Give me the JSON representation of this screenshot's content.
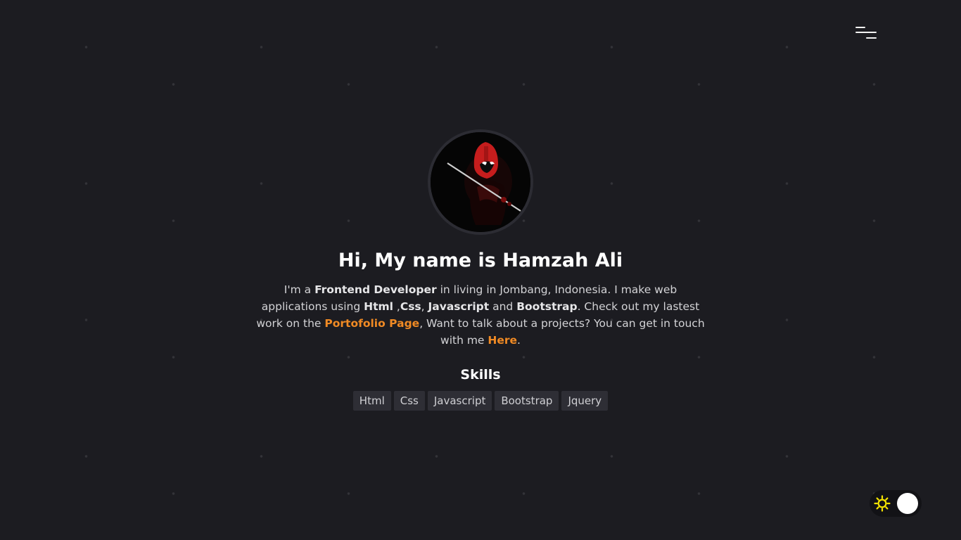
{
  "nav": {
    "menu_icon": "hamburger-menu-icon"
  },
  "profile": {
    "avatar_alt": "avatar",
    "greeting": "Hi, My name is Hamzah Ali"
  },
  "bio": {
    "t1": "I'm a ",
    "role": "Frontend Developer",
    "t2": " in living in Jombang, Indonesia. I make web applications using ",
    "skill_html": "Html",
    "t3": " ,",
    "skill_css": "Css",
    "t4": ", ",
    "skill_js": "Javascript",
    "t5": " and ",
    "skill_bootstrap": "Bootstrap",
    "t6": ". Check out my lastest work on the ",
    "portfolio_link": "Portofolio Page",
    "t7": ", Want to talk about a projects? You can get in touch with me ",
    "contact_link": "Here",
    "t8": "."
  },
  "skills": {
    "heading": "Skills",
    "items": [
      "Html",
      "Css",
      "Javascript",
      "Bootstrap",
      "Jquery"
    ]
  },
  "theme": {
    "icon": "sun-icon",
    "sun_color": "#f5e400",
    "mode": "dark"
  },
  "colors": {
    "background": "#1c1c21",
    "accent": "#f08a24",
    "badge_bg": "#2e2e35"
  }
}
